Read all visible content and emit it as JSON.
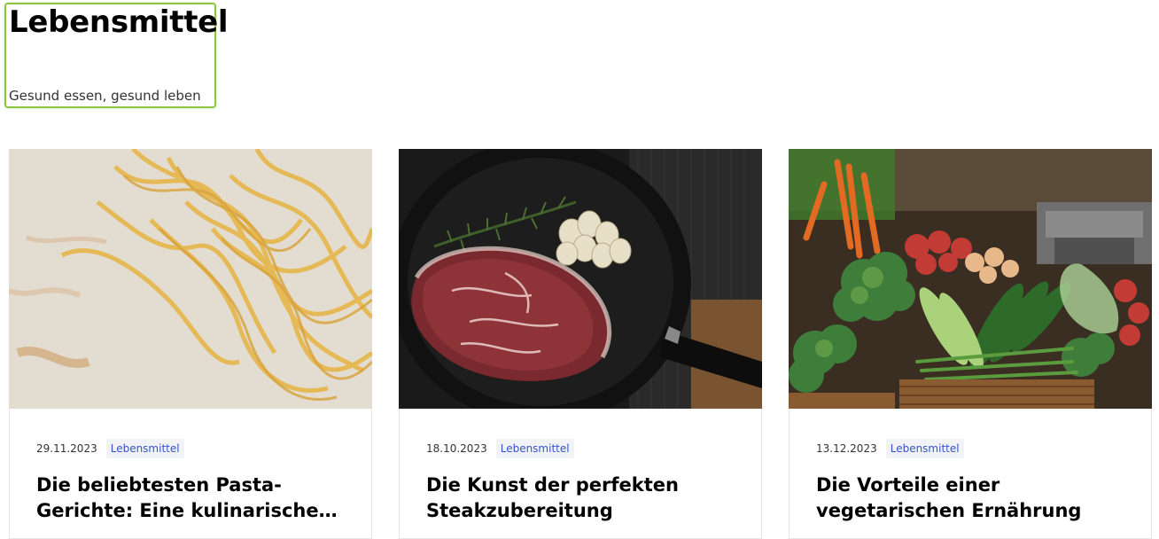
{
  "site": {
    "title": "Lebensmittel",
    "tagline": "Gesund essen, gesund leben",
    "accent_color": "#8cc63f"
  },
  "posts": [
    {
      "date": "29.11.2023",
      "category": "Lebensmittel",
      "title": "Die beliebtesten Pasta-Gerichte: Eine kulinarische Reise",
      "image": "pasta-noodles-photo"
    },
    {
      "date": "18.10.2023",
      "category": "Lebensmittel",
      "title": "Die Kunst der perfekten Steakzubereitung",
      "image": "steak-in-pan-photo"
    },
    {
      "date": "13.12.2023",
      "category": "Lebensmittel",
      "title": "Die Vorteile einer vegetarischen Ernährung",
      "image": "vegetable-market-photo"
    }
  ],
  "category_link_color": "#3552c9"
}
